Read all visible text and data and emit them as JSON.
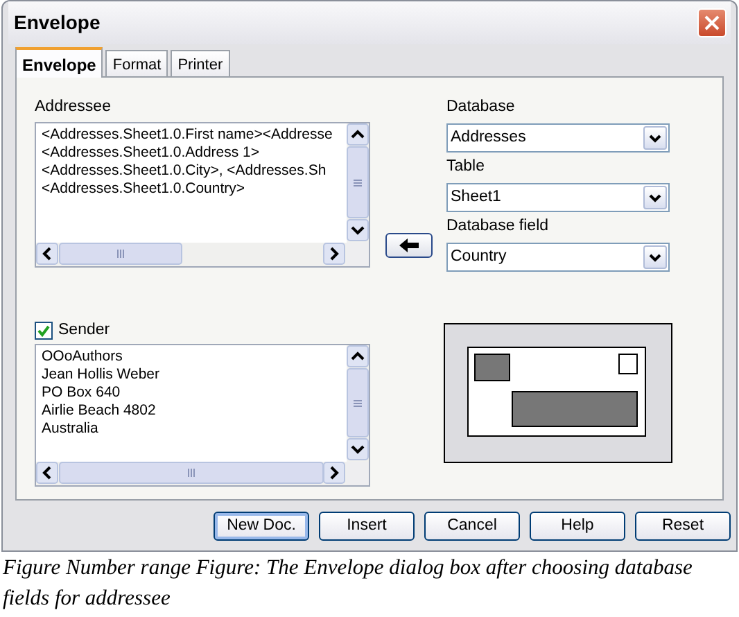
{
  "window": {
    "title": "Envelope"
  },
  "tabs": [
    {
      "label": "Envelope",
      "selected": true
    },
    {
      "label": "Format",
      "selected": false
    },
    {
      "label": "Printer",
      "selected": false
    }
  ],
  "addressee": {
    "label": "Addressee",
    "lines": [
      "<Addresses.Sheet1.0.First name><Addresse",
      "<Addresses.Sheet1.0.Address 1>",
      "<Addresses.Sheet1.0.City>, <Addresses.Sh",
      "<Addresses.Sheet1.0.Country>"
    ]
  },
  "database": {
    "label": "Database",
    "value": "Addresses"
  },
  "table": {
    "label": "Table",
    "value": "Sheet1"
  },
  "database_field": {
    "label": "Database field",
    "value": "Country"
  },
  "sender": {
    "label": "Sender",
    "checked": true,
    "lines": [
      "OOoAuthors",
      "Jean Hollis Weber",
      "PO Box 640",
      "Airlie Beach  4802",
      "Australia"
    ]
  },
  "buttons": [
    {
      "label": "New Doc.",
      "default": true
    },
    {
      "label": "Insert",
      "default": false
    },
    {
      "label": "Cancel",
      "default": false
    },
    {
      "label": "Help",
      "default": false
    },
    {
      "label": "Reset",
      "default": false
    }
  ],
  "caption": "Figure Number range Figure: The Envelope dialog box after choosing database fields for addressee"
}
